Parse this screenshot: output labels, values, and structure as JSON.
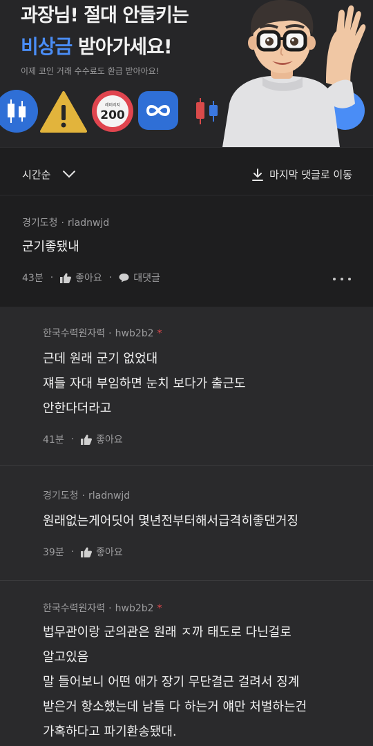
{
  "banner": {
    "title": "과장님! 절대 안들키는",
    "highlight": "비상금",
    "title2_rest": " 받아가세요!",
    "subtitle": "이제 코인 거래 수수료도 환급 받아아요!",
    "badge_caption": "레버리지",
    "badge_value": "200",
    "accent_color": "#4a8df6",
    "icons": [
      "candlestick-icon",
      "warning-icon",
      "leverage-200-icon",
      "infinity-icon",
      "candlestick-icon",
      "memoji-avatar"
    ]
  },
  "sort": {
    "label": "시간순",
    "jump_label": "마지막 댓글로 이동"
  },
  "comment": {
    "author_group": "경기도청",
    "author": "rladnwjd",
    "text": "군기좋됐내",
    "time": "43분",
    "like_label": "좋아요",
    "reply_label": "대댓글"
  },
  "replies": [
    {
      "author_group": "한국수력원자력",
      "author": "hwb2b2",
      "writer_mark": "*",
      "lines": [
        "근데 원래 군기 없었대",
        "쟤들 자대 부임하면 눈치 보다가 출근도",
        "안한다더라고"
      ],
      "time": "41분",
      "like_label": "좋아요"
    },
    {
      "author_group": "경기도청",
      "author": "rladnwjd",
      "lines": [
        "원래없는게어딧어 몇년전부터해서급격히좋댄거징"
      ],
      "time": "39분",
      "like_label": "좋아요"
    },
    {
      "author_group": "한국수력원자력",
      "author": "hwb2b2",
      "writer_mark": "*",
      "lines": [
        "법무관이랑 군의관은 원래 ㅈ까 태도로 다닌걸로",
        "알고있음",
        "말 들어보니 어떤 애가 장기 무단결근 걸려서 징계",
        "받은거 항소했는데 남들 다 하는거 얘만 처벌하는건",
        "가혹하다고 파기환송됐대."
      ]
    }
  ]
}
